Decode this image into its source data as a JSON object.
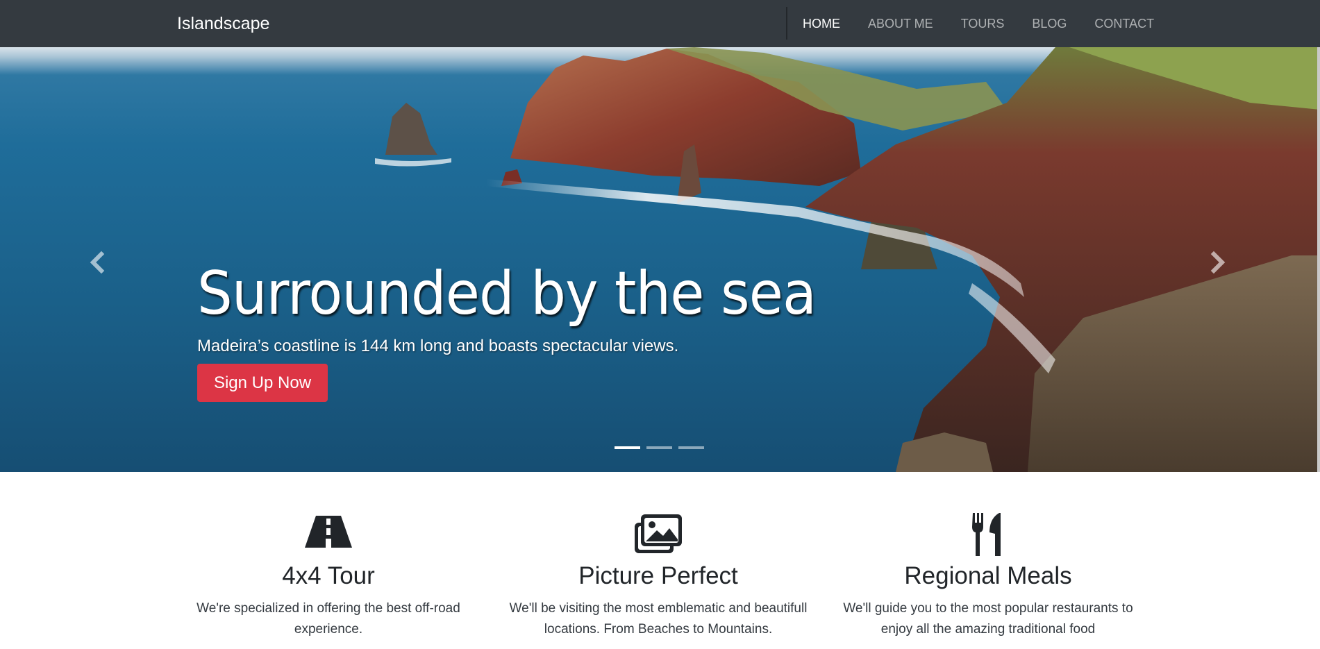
{
  "navbar": {
    "brand": "Islandscape",
    "links": [
      {
        "label": "HOME",
        "active": true
      },
      {
        "label": "ABOUT ME",
        "active": false
      },
      {
        "label": "TOURS",
        "active": false
      },
      {
        "label": "BLOG",
        "active": false
      },
      {
        "label": "CONTACT",
        "active": false
      }
    ]
  },
  "hero": {
    "title": "Surrounded by the sea",
    "subtitle": "Madeira’s coastline is 144 km long and boasts spectacular views.",
    "cta_label": "Sign Up Now",
    "slides_count": 3,
    "active_slide": 1,
    "prev_icon": "chevron-left-icon",
    "next_icon": "chevron-right-icon"
  },
  "features": [
    {
      "icon": "road-icon",
      "title": "4x4 Tour",
      "text": "We're specialized in offering the best off-road experience."
    },
    {
      "icon": "images-icon",
      "title": "Picture Perfect",
      "text": "We'll be visiting the most emblematic and beautifull locations. From Beaches to Mountains."
    },
    {
      "icon": "utensils-icon",
      "title": "Regional Meals",
      "text": "We'll guide you to the most popular restaurants to enjoy all the amazing traditional food"
    }
  ],
  "colors": {
    "navbar_bg": "#343a40",
    "cta_bg": "#dc3545",
    "text_dark": "#212529"
  }
}
